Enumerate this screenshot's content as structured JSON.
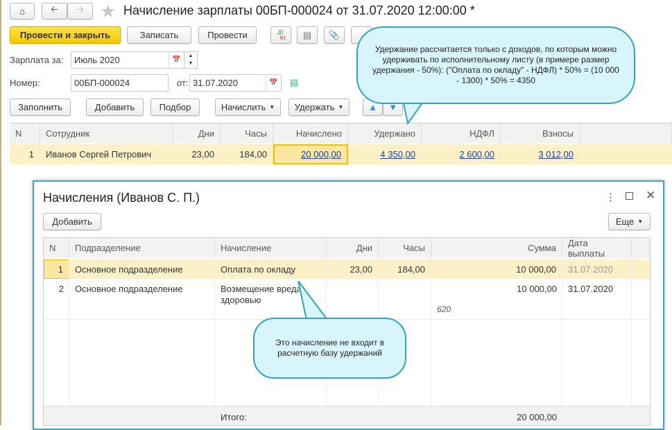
{
  "header": {
    "title": "Начисление зарплаты 00БП-000024 от 31.07.2020 12:00:00 *"
  },
  "toolbar": {
    "post_close": "Провести и закрыть",
    "save": "Записать",
    "post": "Провести",
    "dtkt_dt": "Дт",
    "dtkt_kt": "Кт"
  },
  "form": {
    "salary_for_label": "Зарплата за:",
    "salary_for_value": "Июль 2020",
    "number_label": "Номер:",
    "number_value": "00БП-000024",
    "date_label": "от:",
    "date_value": "31.07.2020"
  },
  "table_toolbar": {
    "fill": "Заполнить",
    "add": "Добавить",
    "select": "Подбор",
    "accrue": "Начислить",
    "withhold": "Удержать"
  },
  "main_table": {
    "columns": [
      "N",
      "Сотрудник",
      "Дни",
      "Часы",
      "Начислено",
      "Удержано",
      "НДФЛ",
      "Взносы"
    ],
    "rows": [
      {
        "n": "1",
        "employee": "Иванов Сергей Петрович",
        "days": "23,00",
        "hours": "184,00",
        "accrued": "20 000,00",
        "withheld": "4 350,00",
        "ndfl": "2 600,00",
        "contrib": "3 012,00"
      }
    ]
  },
  "callout1": {
    "text": "Удержание рассчитается только с доходов, по которым можно удерживать по исполнительному листу (в примере размер удержания - 50%): (\"Оплата по окладу\" - НДФЛ) * 50% = (10 000 - 1300) * 50% = 4350"
  },
  "dialog": {
    "title": "Начисления (Иванов С. П.)",
    "add": "Добавить",
    "more": "Еще",
    "columns": [
      "N",
      "Подразделение",
      "Начисление",
      "Дни",
      "Часы",
      "Сумма",
      "Дата выплаты"
    ],
    "rows": [
      {
        "n": "1",
        "dept": "Основное подразделение",
        "accrual": "Оплата по окладу",
        "days": "23,00",
        "hours": "184,00",
        "sum": "10 000,00",
        "date": "31.07.2020"
      },
      {
        "n": "2",
        "dept": "Основное подразделение",
        "accrual": "Возмещение вреда здоровью",
        "days": "",
        "hours": "",
        "sum": "10 000,00",
        "date": "31.07.2020"
      }
    ],
    "code_note": "620",
    "total_label": "Итого:",
    "total_sum": "20 000,00"
  },
  "callout2": {
    "text": "Это начисление не входит в расчетную базу удержаний"
  }
}
